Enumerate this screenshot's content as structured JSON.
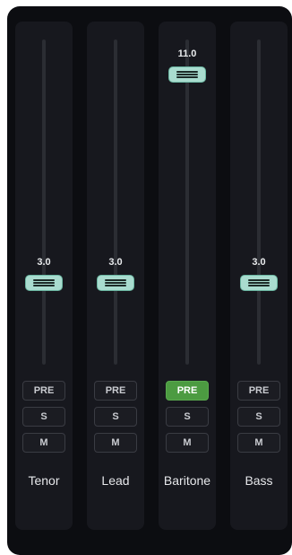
{
  "channels": [
    {
      "name": "Tenor",
      "value_label": "3.0",
      "level": 0.21,
      "pre_label": "PRE",
      "solo_label": "S",
      "mute_label": "M",
      "pre_active": false
    },
    {
      "name": "Lead",
      "value_label": "3.0",
      "level": 0.21,
      "pre_label": "PRE",
      "solo_label": "S",
      "mute_label": "M",
      "pre_active": false
    },
    {
      "name": "Baritone",
      "value_label": "11.0",
      "level": 1.0,
      "pre_label": "PRE",
      "solo_label": "S",
      "mute_label": "M",
      "pre_active": true
    },
    {
      "name": "Bass",
      "value_label": "3.0",
      "level": 0.21,
      "pre_label": "PRE",
      "solo_label": "S",
      "mute_label": "M",
      "pre_active": false
    }
  ],
  "colors": {
    "panel": "#0c0d11",
    "strip": "#17181e",
    "thumb": "#a9dccf",
    "pre_active": "#4c9b41"
  }
}
